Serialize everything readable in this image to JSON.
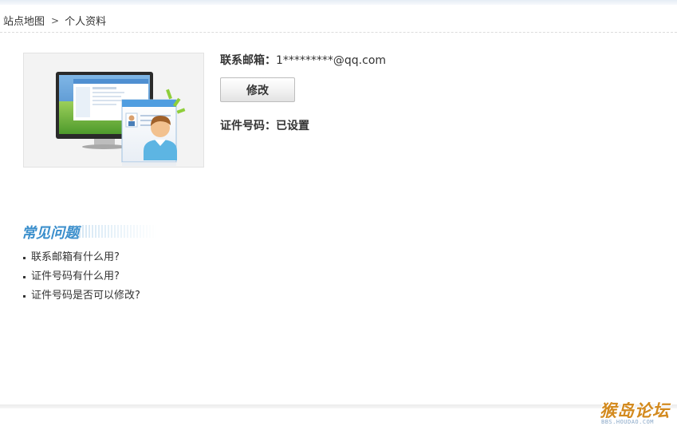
{
  "breadcrumb": {
    "home": "站点地图",
    "separator": ">",
    "current": "个人资料"
  },
  "contact": {
    "email_label": "联系邮箱：",
    "email_value": "1*********@qq.com",
    "modify_button": "修改"
  },
  "idcard": {
    "label": "证件号码：",
    "value": "已设置"
  },
  "faq": {
    "title": "常见问题",
    "items": [
      "联系邮箱有什么用?",
      "证件号码有什么用?",
      "证件号码是否可以修改?"
    ]
  },
  "watermark": {
    "main": "猴岛论坛",
    "sub": "BBS.HOUDAO.COM"
  },
  "colors": {
    "faq_title": "#3b8fcc",
    "watermark": "#d38a1e"
  }
}
